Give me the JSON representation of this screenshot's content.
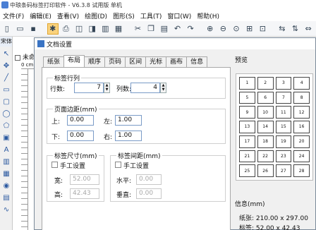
{
  "app": {
    "title": "中琅条码标签打印软件 - V6.3.8 试用版 单机"
  },
  "menu": [
    "文件(F)",
    "编辑(E)",
    "查看(V)",
    "绘图(D)",
    "图形(S)",
    "工具(T)",
    "窗口(W)",
    "帮助(H)"
  ],
  "toolbar": {
    "icons": [
      "new-icon",
      "open-icon",
      "save-icon",
      "settings-icon",
      "print-icon",
      "print-preview-icon",
      "print-setup-icon",
      "barcode-icon",
      "grid-icon",
      "cut-icon",
      "copy-icon",
      "paste-icon",
      "undo-icon",
      "redo-icon",
      "zoom-in-icon",
      "zoom-out-icon",
      "zoom-fit-icon",
      "zoom-page-icon",
      "fit-icon",
      "align-icon",
      "align2-icon",
      "distribute-icon"
    ]
  },
  "left_panel": {
    "head": "宋体"
  },
  "doc": {
    "tab_label": "未命",
    "ruler_label": "0 cm"
  },
  "dialog": {
    "title": "文档设置",
    "tabs": [
      "纸张",
      "布局",
      "顺序",
      "页码",
      "区间",
      "光标",
      "画布",
      "信息"
    ],
    "active_tab": "布局",
    "label_rows_cols": {
      "title": "标签行列",
      "rows_label": "行数:",
      "rows_value": "7",
      "cols_label": "列数:",
      "cols_value": "4"
    },
    "page_margins": {
      "title": "页面边距(mm)",
      "top_label": "上:",
      "top_value": "0.00",
      "left_label": "左:",
      "left_value": "1.00",
      "bottom_label": "下:",
      "bottom_value": "0.00",
      "right_label": "右:",
      "right_value": "1.00"
    },
    "label_size": {
      "title": "标签尺寸(mm)",
      "manual_label": "手工设置",
      "width_label": "宽:",
      "width_value": "52.00",
      "height_label": "高:",
      "height_value": "42.43"
    },
    "label_spacing": {
      "title": "标签间距(mm)",
      "manual_label": "手工设置",
      "h_label": "水平:",
      "h_value": "0.00",
      "v_label": "垂直:",
      "v_value": "0.00"
    },
    "preview": {
      "title": "预览",
      "cells": [
        "1",
        "2",
        "3",
        "4",
        "5",
        "6",
        "7",
        "8",
        "9",
        "10",
        "11",
        "12",
        "13",
        "14",
        "15",
        "16",
        "17",
        "18",
        "19",
        "20",
        "21",
        "22",
        "23",
        "24",
        "25",
        "26",
        "27",
        "28"
      ]
    },
    "info": {
      "title": "信息(mm)",
      "paper": "纸张: 210.00 x 297.00",
      "label": "标签: 52.00 x 42.43"
    }
  }
}
